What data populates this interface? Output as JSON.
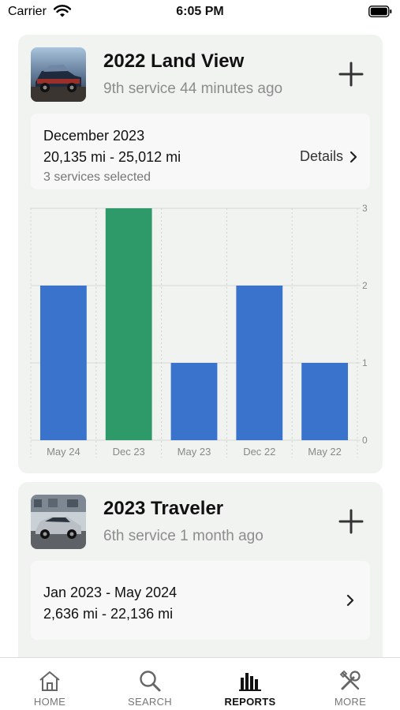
{
  "status_bar": {
    "carrier": "Carrier",
    "time": "6:05 PM"
  },
  "vehicles": [
    {
      "name": "2022 Land View",
      "subtitle": "9th service 44 minutes ago",
      "period": "December 2023",
      "miles": "20,135 mi - 25,012 mi",
      "services_selected": "3 services selected",
      "details_label": "Details"
    },
    {
      "name": "2023 Traveler",
      "subtitle": "6th service 1 month ago",
      "period": "Jan 2023 - May 2024",
      "miles": "2,636 mi - 22,136 mi"
    }
  ],
  "chart_data": {
    "type": "bar",
    "categories": [
      "May 24",
      "Dec 23",
      "May 23",
      "Dec 22",
      "May 22"
    ],
    "values": [
      2,
      3,
      1,
      2,
      1
    ],
    "selected_index": 1,
    "ylim": [
      0,
      3
    ],
    "yticks": [
      "0",
      "1",
      "2",
      "3"
    ],
    "bar_color": "#3a73cc",
    "selected_color": "#2e9a6a",
    "grid": true
  },
  "tabs": [
    {
      "label": "HOME",
      "icon": "home-icon",
      "active": false
    },
    {
      "label": "SEARCH",
      "icon": "search-icon",
      "active": false
    },
    {
      "label": "REPORTS",
      "icon": "reports-icon",
      "active": true
    },
    {
      "label": "MORE",
      "icon": "tools-icon",
      "active": false
    }
  ]
}
